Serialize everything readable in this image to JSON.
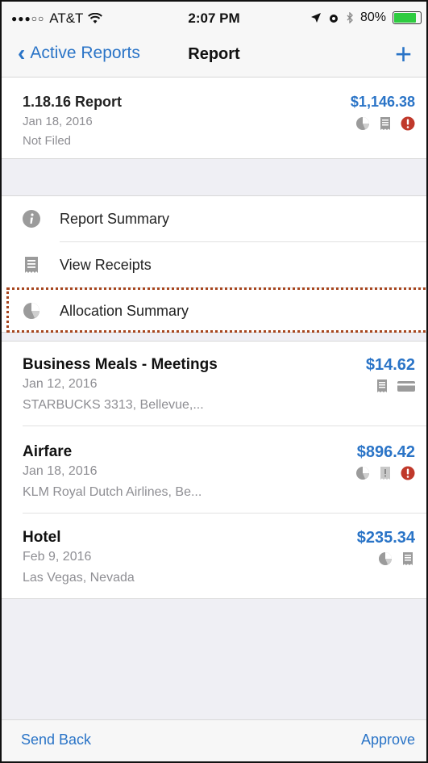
{
  "status_bar": {
    "signal": "●●●○○",
    "carrier": "AT&T",
    "wifi_icon": "wifi-icon",
    "time": "2:07 PM",
    "battery_text": "80%"
  },
  "nav": {
    "back_label": "Active Reports",
    "title": "Report",
    "add_label": "+"
  },
  "report": {
    "name": "1.18.16 Report",
    "date": "Jan 18, 2016",
    "status": "Not Filed",
    "amount": "$1,146.38"
  },
  "menu": {
    "items": [
      {
        "label": "Report Summary",
        "icon": "info-icon"
      },
      {
        "label": "View Receipts",
        "icon": "receipt-icon"
      },
      {
        "label": "Allocation Summary",
        "icon": "pie-chart-icon"
      }
    ]
  },
  "expenses": [
    {
      "name": "Business Meals - Meetings",
      "date": "Jan 12, 2016",
      "vendor": "STARBUCKS 3313, Bellevue,...",
      "amount": "$14.62"
    },
    {
      "name": "Airfare",
      "date": "Jan 18, 2016",
      "vendor": "KLM Royal Dutch Airlines, Be...",
      "amount": "$896.42"
    },
    {
      "name": "Hotel",
      "date": "Feb 9, 2016",
      "vendor": "Las Vegas, Nevada",
      "amount": "$235.34"
    }
  ],
  "toolbar": {
    "left_label": "Send Back",
    "right_label": "Approve"
  },
  "colors": {
    "accent": "#2a74c7",
    "alert": "#c0392b",
    "highlight": "#a6451e"
  }
}
